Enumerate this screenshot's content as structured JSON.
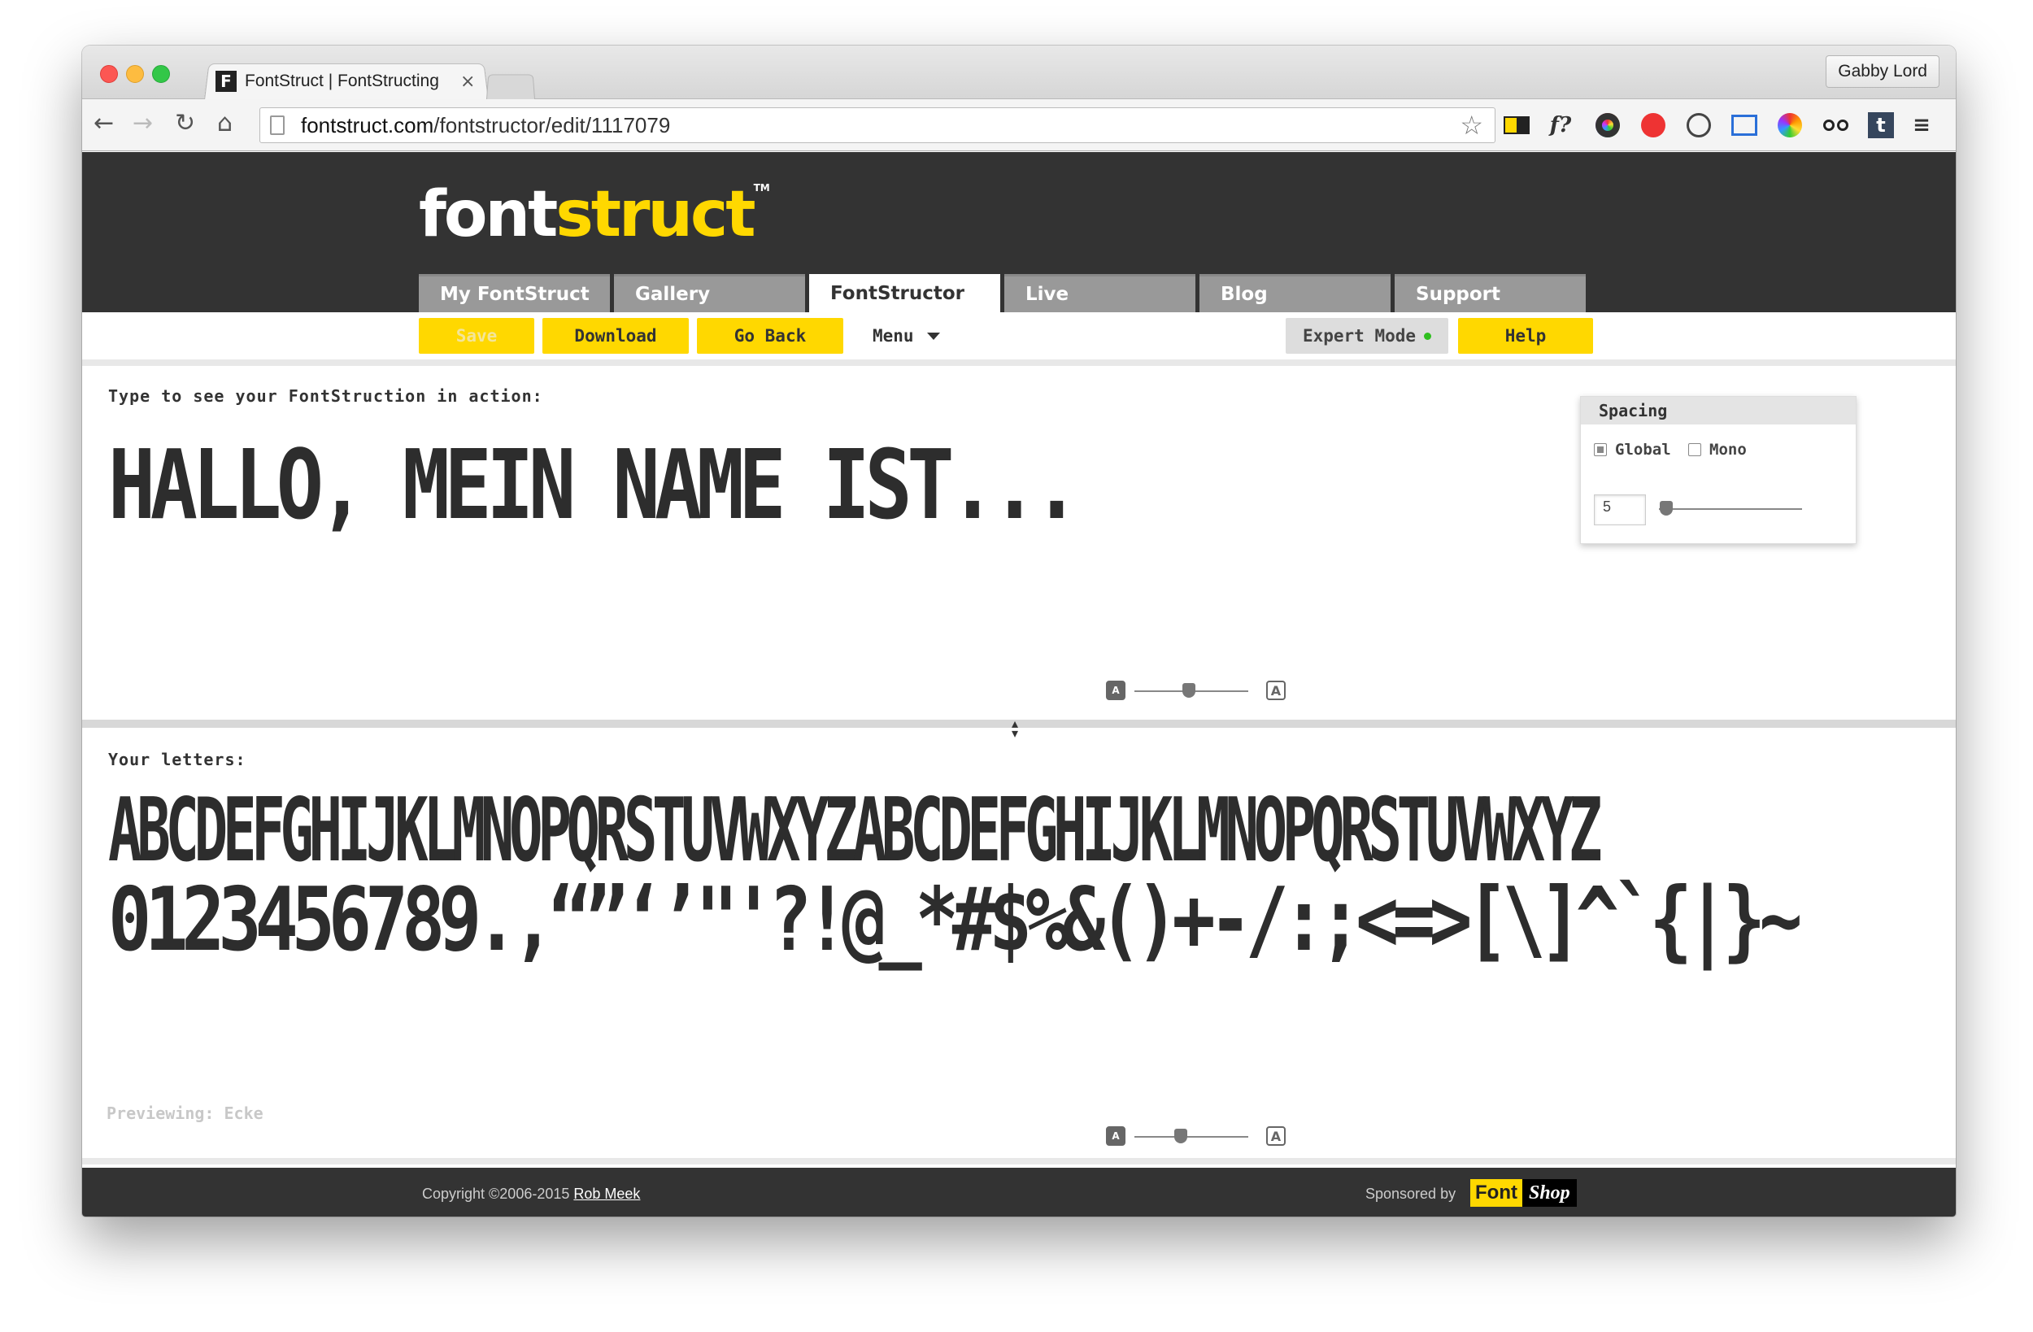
{
  "browser": {
    "tab_title": "FontStruct | FontStructing",
    "tab_close": "×",
    "favicon_letter": "F",
    "profile_name": "Gabby Lord",
    "url_host": "fontstruct.com",
    "url_path": "/fontstructor/edit/1117079",
    "nav_back": "←",
    "nav_forward": "→",
    "nav_reload": "↻",
    "nav_home": "⌂",
    "bookmark_star": "☆",
    "ext_fonts_label": "f?",
    "ext_menu": "≡"
  },
  "site": {
    "logo_white": "font",
    "logo_yellow": "struct",
    "logo_tm": "TM",
    "nav_tabs": [
      "My FontStruct",
      "Gallery",
      "FontStructor",
      "Live",
      "Blog",
      "Support"
    ],
    "active_tab_index": 2,
    "actions": {
      "save": "Save",
      "download": "Download",
      "go_back": "Go Back",
      "menu": "Menu",
      "expert_mode": "Expert Mode",
      "help": "Help"
    },
    "typing_label": "Type to see your FontStruction in action:",
    "typed_text": "HALLO, MEIN NAME IST...",
    "spacing": {
      "title": "Spacing",
      "option_global": "Global",
      "option_mono": "Mono",
      "selected": "Global",
      "value": "5",
      "slider_level": 0.05
    },
    "preview_size_level_top": 0.48,
    "preview_size_level_bottom": 0.41,
    "size_icon_small": "A",
    "size_icon_large": "A",
    "letters_label": "Your letters:",
    "letters_line1": "ABCDEFGHIJKLMNOPQRSTUVWXYZABCDEFGHIJKLMNOPQRSTUVWXYZ",
    "letters_line2": "0123456789.,“”‘’\"'?!@_*#$%&()+-/:;<=>[\\]^`{|}~",
    "previewing": "Previewing: Ecke",
    "footer": {
      "copyright_prefix": "Copyright ©2006-2015 ",
      "copyright_author": "Rob Meek",
      "sponsored_by": "Sponsored by",
      "sponsor_font": "Font",
      "sponsor_shop": "Shop"
    }
  },
  "colors": {
    "brand_yellow": "#ffd800",
    "header_dark": "#333333",
    "tab_grey": "#999999",
    "expert_dot": "#2fbf1f"
  }
}
